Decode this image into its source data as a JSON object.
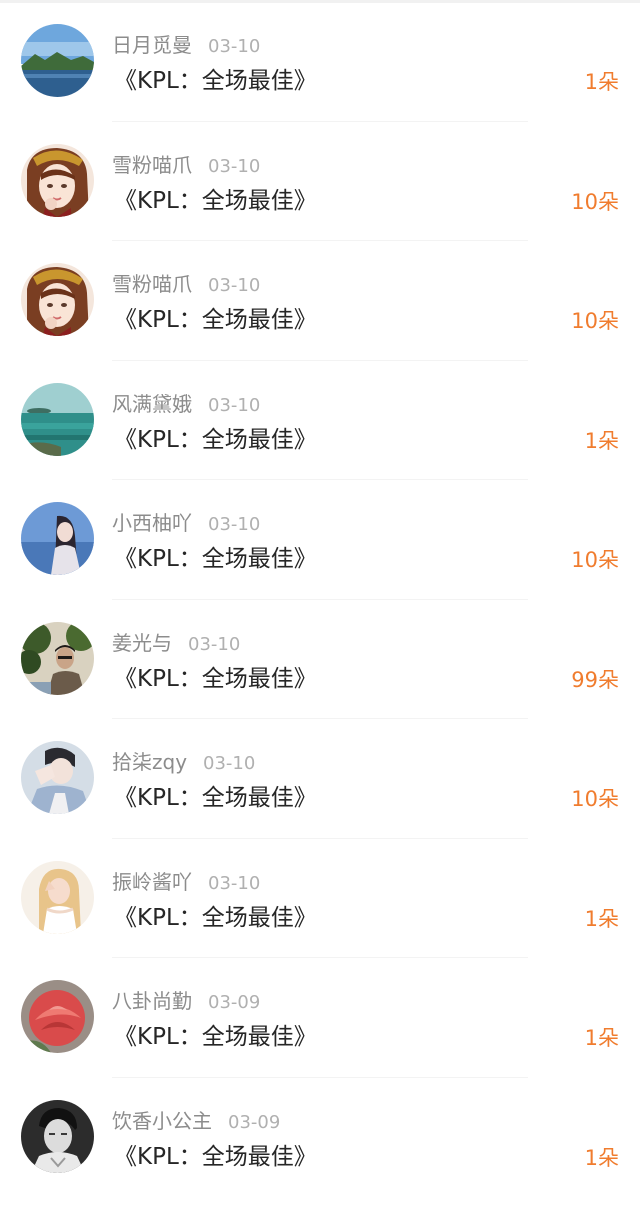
{
  "gifts": [
    {
      "name": "日月觅曼",
      "date": "03-10",
      "gift": "《KPL：全场最佳》",
      "count": "1朵",
      "avatar_icon": "landscape-lake-icon"
    },
    {
      "name": "雪粉喵爪",
      "date": "03-10",
      "gift": "《KPL：全场最佳》",
      "count": "10朵",
      "avatar_icon": "anime-girl-icon"
    },
    {
      "name": "雪粉喵爪",
      "date": "03-10",
      "gift": "《KPL：全场最佳》",
      "count": "10朵",
      "avatar_icon": "anime-girl-icon"
    },
    {
      "name": "风满黛娥",
      "date": "03-10",
      "gift": "《KPL：全场最佳》",
      "count": "1朵",
      "avatar_icon": "sea-island-icon"
    },
    {
      "name": "小西柚吖",
      "date": "03-10",
      "gift": "《KPL：全场最佳》",
      "count": "10朵",
      "avatar_icon": "girl-by-sea-icon"
    },
    {
      "name": "姜光与",
      "date": "03-10",
      "gift": "《KPL：全场最佳》",
      "count": "99朵",
      "avatar_icon": "man-with-trees-icon"
    },
    {
      "name": "拾柒zqy",
      "date": "03-10",
      "gift": "《KPL：全场最佳》",
      "count": "10朵",
      "avatar_icon": "boy-hand-face-icon"
    },
    {
      "name": "振岭酱吖",
      "date": "03-10",
      "gift": "《KPL：全场最佳》",
      "count": "1朵",
      "avatar_icon": "blonde-girl-icon"
    },
    {
      "name": "八卦尚勤",
      "date": "03-09",
      "gift": "《KPL：全场最佳》",
      "count": "1朵",
      "avatar_icon": "red-rose-icon"
    },
    {
      "name": "饮香小公主",
      "date": "03-09",
      "gift": "《KPL：全场最佳》",
      "count": "1朵",
      "avatar_icon": "man-portrait-bw-icon"
    }
  ],
  "colors": {
    "count_accent": "#f07c2e",
    "name_gray": "#8c8c8c",
    "date_gray": "#b0b0b0",
    "gift_text": "#262626"
  }
}
